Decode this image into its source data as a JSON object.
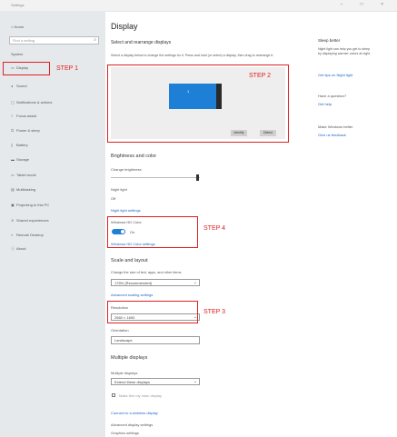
{
  "window": {
    "title": "Settings",
    "controls": "–  □  ×"
  },
  "sidebar": {
    "home_label": "Home",
    "search_placeholder": "Find a setting",
    "section_label": "System",
    "items": [
      {
        "label": "Display",
        "icon": "monitor-icon"
      },
      {
        "label": "Sound",
        "icon": "speaker-icon"
      },
      {
        "label": "Notifications & actions",
        "icon": "chat-icon"
      },
      {
        "label": "Focus assist",
        "icon": "moon-icon"
      },
      {
        "label": "Power & sleep",
        "icon": "power-icon"
      },
      {
        "label": "Battery",
        "icon": "battery-icon"
      },
      {
        "label": "Storage",
        "icon": "storage-icon"
      },
      {
        "label": "Tablet mode",
        "icon": "tablet-icon"
      },
      {
        "label": "Multitasking",
        "icon": "multitasking-icon"
      },
      {
        "label": "Projecting to this PC",
        "icon": "project-icon"
      },
      {
        "label": "Shared experiences",
        "icon": "share-icon"
      },
      {
        "label": "Remote Desktop",
        "icon": "remote-icon"
      },
      {
        "label": "About",
        "icon": "info-icon"
      }
    ]
  },
  "main": {
    "title": "Display",
    "subtitle": "Select and rearrange displays",
    "description": "Select a display below to change the settings for it. Press and hold (or select) a display, then drag to rearrange it.",
    "monitor_label": "1",
    "identify_label": "Identify",
    "detect_label": "Detect",
    "color_heading": "Brightness and color",
    "brightness_label": "Change brightness",
    "night_light_label": "Night light",
    "night_light_value": "Off",
    "night_light_link": "Night light settings",
    "hdr_label": "Windows HD Color",
    "hdr_value": "On",
    "hdr_link": "Windows HD Color settings",
    "scale_heading": "Scale and layout",
    "scale_label": "Change the size of text, apps, and other items",
    "scale_value": "175% (Recommended)",
    "advanced_scaling_link": "Advanced scaling settings",
    "resolution_label": "Resolution",
    "resolution_value": "2560 × 1600",
    "orientation_label": "Orientation",
    "orientation_value": "Landscape",
    "multi_heading": "Multiple displays",
    "multi_label": "Multiple displays",
    "multi_value": "Extend these displays",
    "main_display_label": "Make this my main display",
    "connect_link": "Connect to a wireless display",
    "adv_display_link": "Advanced display settings",
    "graphics_label": "Graphics settings"
  },
  "right_panel": {
    "heading": "Sleep better",
    "text": "Night light can help you get to sleep by displaying warmer colors at night.",
    "link": "Get tips on Night light",
    "question": "Have a question?",
    "help_link": "Get help",
    "feedback_heading": "Make Windows better",
    "feedback_link": "Give us feedback"
  },
  "annotations": {
    "step1": "STEP 1",
    "step2": "STEP 2",
    "step3": "STEP 3",
    "step4": "STEP 4",
    "color": "#e02020"
  },
  "colors": {
    "accent": "#1e7fd6",
    "sidebar_bg": "#e6e9ec"
  }
}
